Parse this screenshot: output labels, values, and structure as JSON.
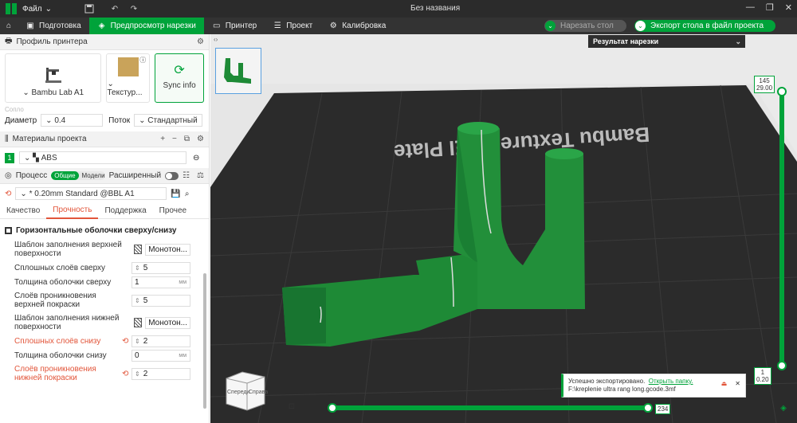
{
  "titlebar": {
    "menu_label": "Файл",
    "window_title": "Без названия"
  },
  "tabs": [
    {
      "label": "Подготовка"
    },
    {
      "label": "Предпросмотр нарезки"
    },
    {
      "label": "Принтер"
    },
    {
      "label": "Проект"
    },
    {
      "label": "Калибровка"
    }
  ],
  "toolbar": {
    "slice_label": "Нарезать стол",
    "export_label": "Экспорт стола в файл проекта"
  },
  "printer": {
    "section_title": "Профиль принтера",
    "printer_name": "Bambu Lab A1",
    "plate_name": "Текстур...",
    "sync_label": "Sync info",
    "sublabel": "Сопло",
    "diameter_label": "Диаметр",
    "diameter_value": "0.4",
    "flow_label": "Поток",
    "flow_value": "Стандартный"
  },
  "materials": {
    "section_title": "Материалы проекта",
    "slot": "1",
    "filament": "ABS"
  },
  "process": {
    "section_title": "Процесс",
    "mode_global": "Общие",
    "mode_models": "Модели",
    "advanced_label": "Расширенный",
    "preset": "* 0.20mm Standard @BBL A1",
    "subtabs": [
      "Качество",
      "Прочность",
      "Поддержка",
      "Прочее"
    ],
    "group_title": "Горизонтальные оболочки сверху/снизу",
    "params": [
      {
        "label": "Шаблон заполнения верхней поверхности",
        "value": "Монотон...",
        "unit": "",
        "modified": false,
        "pattern": true
      },
      {
        "label": "Сплошных слоёв сверху",
        "value": "5",
        "unit": "",
        "modified": false,
        "pattern": false
      },
      {
        "label": "Толщина оболочки сверху",
        "value": "1",
        "unit": "мм",
        "modified": false,
        "pattern": false
      },
      {
        "label": "Слоёв проникновения верхней покраски",
        "value": "5",
        "unit": "",
        "modified": false,
        "pattern": false
      },
      {
        "label": "Шаблон заполнения нижней поверхности",
        "value": "Монотон...",
        "unit": "",
        "modified": false,
        "pattern": true
      },
      {
        "label": "Сплошных слоёв снизу",
        "value": "2",
        "unit": "",
        "modified": true,
        "pattern": false
      },
      {
        "label": "Толщина оболочки снизу",
        "value": "0",
        "unit": "мм",
        "modified": false,
        "pattern": false
      },
      {
        "label": "Слоёв проникновения нижней покраски",
        "value": "2",
        "unit": "",
        "modified": true,
        "pattern": false
      }
    ]
  },
  "viewport": {
    "bed_text": "Bambu Textured PEI Plate",
    "result_title": "Результат нарезки",
    "layer_top": "145",
    "height_top": "29.00",
    "layer_bottom": "1",
    "height_bottom": "0.20",
    "move_value": "234",
    "cube_front": "Спереди",
    "cube_right": "Справа"
  },
  "notification": {
    "text": "Успешно экспортировано.",
    "link": "Открыть папку.",
    "path": "F:\\kreplenie ultra rang long.gcode.3mf"
  },
  "colors": {
    "accent": "#00a33a",
    "model": "#1e8a36",
    "modified": "#e2553a",
    "bed": "#2a2a2a"
  }
}
